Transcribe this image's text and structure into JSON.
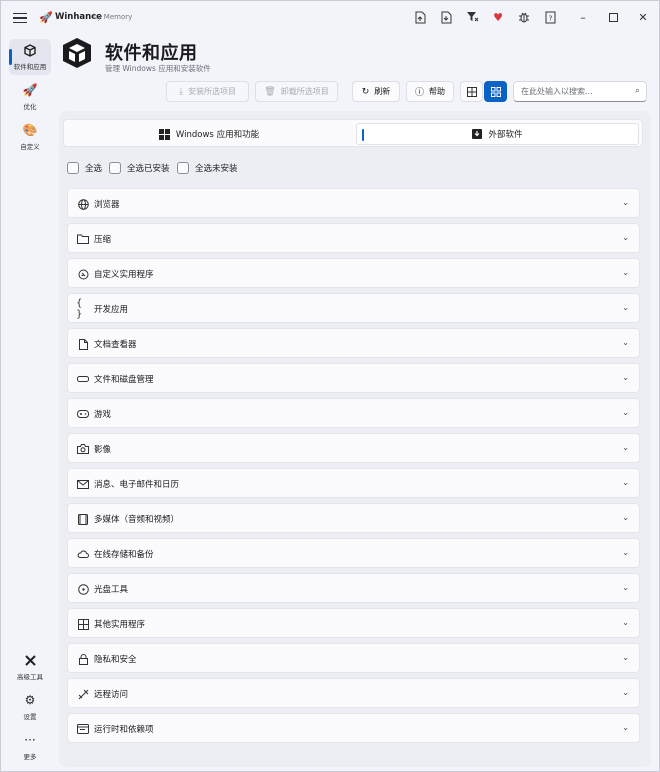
{
  "titlebar": {
    "app_name": "Winhance",
    "by_line": "by Memory"
  },
  "sidebar": {
    "items": [
      {
        "label": "软件和应用",
        "icon": "cube-icon",
        "active": true
      },
      {
        "label": "优化",
        "icon": "rocket-icon",
        "active": false
      },
      {
        "label": "自定义",
        "icon": "palette-icon",
        "active": false
      }
    ],
    "bottom_items": [
      {
        "label": "高级工具",
        "icon": "tools-icon"
      },
      {
        "label": "设置",
        "icon": "gear-icon"
      },
      {
        "label": "更多",
        "icon": "more-icon"
      }
    ]
  },
  "header": {
    "title": "软件和应用",
    "subtitle": "管理 Windows 应用和安装软件"
  },
  "toolbar": {
    "install_label": "安装所选项目",
    "uninstall_label": "卸载所选项目",
    "refresh_label": "刷新",
    "help_label": "帮助",
    "search_placeholder": "在此处输入以搜索..."
  },
  "tabs": [
    {
      "label": "Windows 应用和功能",
      "icon": "windows-icon",
      "active": false
    },
    {
      "label": "外部软件",
      "icon": "download-box-icon",
      "active": true
    }
  ],
  "select": {
    "all": "全选",
    "installed": "全选已安装",
    "not_installed": "全选未安装"
  },
  "categories": [
    {
      "label": "浏览器",
      "icon": "globe-icon"
    },
    {
      "label": "压缩",
      "icon": "folder-icon"
    },
    {
      "label": "自定义实用程序",
      "icon": "custom-tools-icon"
    },
    {
      "label": "开发应用",
      "icon": "braces-icon"
    },
    {
      "label": "文档查看器",
      "icon": "document-icon"
    },
    {
      "label": "文件和磁盘管理",
      "icon": "drive-icon"
    },
    {
      "label": "游戏",
      "icon": "gamepad-icon"
    },
    {
      "label": "影像",
      "icon": "camera-icon"
    },
    {
      "label": "消息、电子邮件和日历",
      "icon": "mail-icon"
    },
    {
      "label": "多媒体（音频和视频）",
      "icon": "media-icon"
    },
    {
      "label": "在线存储和备份",
      "icon": "cloud-icon"
    },
    {
      "label": "光盘工具",
      "icon": "disc-icon"
    },
    {
      "label": "其他实用程序",
      "icon": "grid-icon"
    },
    {
      "label": "隐私和安全",
      "icon": "lock-icon"
    },
    {
      "label": "远程访问",
      "icon": "remote-icon"
    },
    {
      "label": "运行时和依赖项",
      "icon": "runtime-icon"
    }
  ],
  "colors": {
    "accent": "#0a63c4",
    "heart": "#d9363e"
  }
}
